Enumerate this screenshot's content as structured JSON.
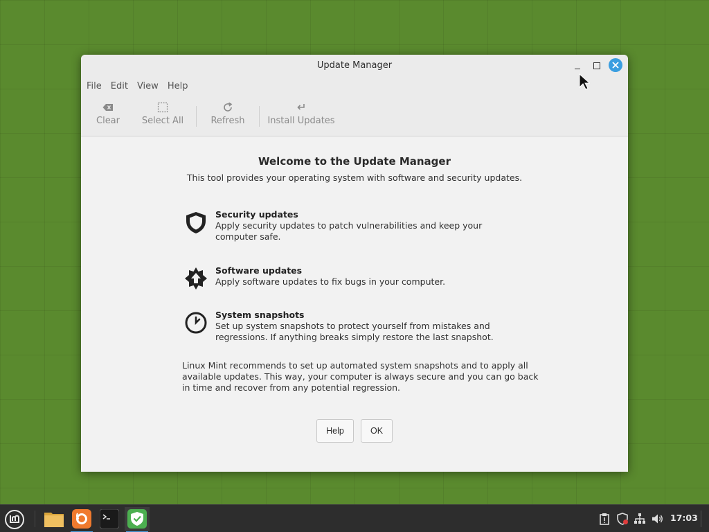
{
  "window": {
    "title": "Update Manager"
  },
  "menu": {
    "items": [
      "File",
      "Edit",
      "View",
      "Help"
    ]
  },
  "toolbar": {
    "clear": "Clear",
    "select_all": "Select All",
    "refresh": "Refresh",
    "install_updates": "Install Updates"
  },
  "welcome": {
    "title": "Welcome to the Update Manager",
    "subtitle": "This tool provides your operating system with software and security updates."
  },
  "features": [
    {
      "icon": "shield-icon",
      "title": "Security updates",
      "description": "Apply security updates to patch vulnerabilities and keep your computer safe."
    },
    {
      "icon": "upgrade-star-icon",
      "title": "Software updates",
      "description": "Apply software updates to fix bugs in your computer."
    },
    {
      "icon": "clock-icon",
      "title": "System snapshots",
      "description": "Set up system snapshots to protect yourself from mistakes and regressions. If anything breaks simply restore the last snapshot."
    }
  ],
  "recommendation": "Linux Mint recommends to set up automated system snapshots and to apply all available updates. This way, your computer is always secure and you can go back in time and recover from any potential regression.",
  "buttons": {
    "help": "Help",
    "ok": "OK"
  },
  "taskbar": {
    "apps": [
      "file-manager-icon",
      "firefox-icon",
      "terminal-icon",
      "update-manager-icon"
    ],
    "clock": "17:03"
  },
  "colors": {
    "desktop": "#5a8a2e",
    "accent": "#3a9ee0",
    "update_green": "#4caf50"
  }
}
